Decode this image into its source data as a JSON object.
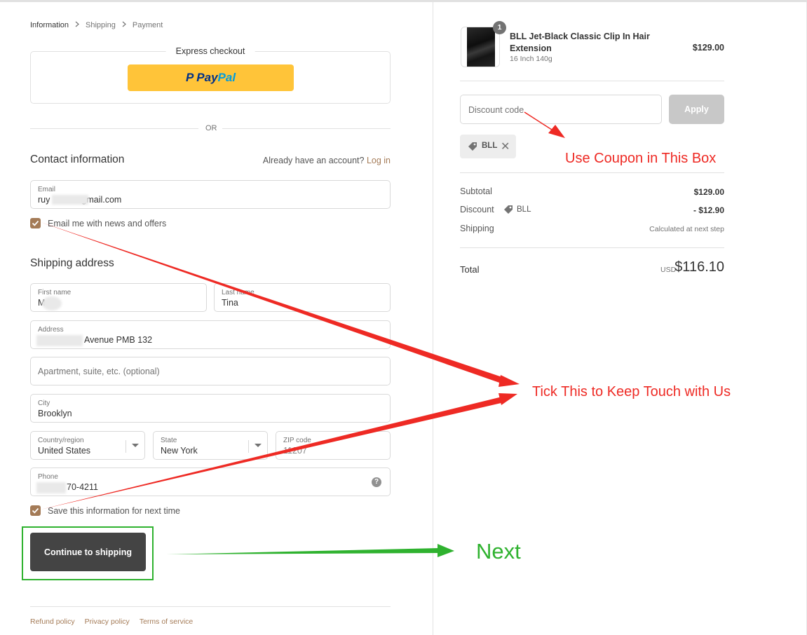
{
  "breadcrumb": {
    "items": [
      "Information",
      "Shipping",
      "Payment"
    ]
  },
  "express": {
    "title": "Express checkout",
    "paypal_pay": "Pay",
    "paypal_pal": "Pal",
    "paypal_mark": "P"
  },
  "divider": {
    "or": "OR"
  },
  "contact": {
    "title": "Contact information",
    "account_prompt": "Already have an account?",
    "login_link": "Log in",
    "email_label": "Email",
    "email_prefix": "ruy",
    "email_suffix": "gmail.com",
    "newsletter_label": "Email me with news and offers"
  },
  "shipping": {
    "title": "Shipping address",
    "first_name_label": "First name",
    "first_name_value": "M",
    "last_name_label": "Last name",
    "last_name_value": "Tina",
    "address_label": "Address",
    "address_value": "Avenue PMB 132",
    "apartment_placeholder": "Apartment, suite, etc. (optional)",
    "city_label": "City",
    "city_value": "Brooklyn",
    "country_label": "Country/region",
    "country_value": "United States",
    "state_label": "State",
    "state_value": "New York",
    "zip_label": "ZIP code",
    "zip_value": "11207",
    "phone_label": "Phone",
    "phone_value": "70-4211",
    "help_glyph": "?",
    "save_label": "Save this information for next time",
    "continue_label": "Continue to shipping"
  },
  "footer": {
    "links": [
      "Refund policy",
      "Privacy policy",
      "Terms of service"
    ]
  },
  "order": {
    "quantity": "1",
    "product_name": "BLL Jet-Black Classic Clip In Hair Extension",
    "product_variant": "16 Inch 140g",
    "product_price": "$129.00",
    "discount_placeholder": "Discount code",
    "apply_label": "Apply",
    "applied_code": "BLL",
    "remove_glyph": "✕",
    "subtotal_label": "Subtotal",
    "subtotal_value": "$129.00",
    "discount_label": "Discount",
    "discount_code": "BLL",
    "discount_value": "- $12.90",
    "shipping_label": "Shipping",
    "shipping_value": "Calculated at next step",
    "total_label": "Total",
    "total_currency": "USD",
    "total_value": "$116.10"
  },
  "annotations": {
    "coupon": "Use Coupon in This Box",
    "tick": "Tick This to Keep Touch with Us",
    "next": "Next",
    "red_color": "#ee2a24",
    "green_color": "#2fb22f"
  },
  "colors": {
    "accent": "#a47b57",
    "paypal_yellow": "#ffc439",
    "button_dark": "#444444"
  }
}
